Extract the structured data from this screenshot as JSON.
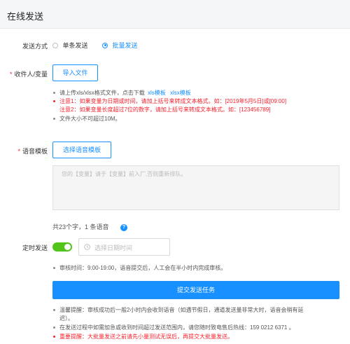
{
  "header": {
    "title": "在线发送"
  },
  "send_mode": {
    "label": "发送方式",
    "options": [
      {
        "label": "单条发送",
        "selected": false
      },
      {
        "label": "批量发送",
        "selected": true
      }
    ]
  },
  "recipients": {
    "label": "收件人/变量",
    "import_button": "导入文件",
    "notes": {
      "line1_prefix": "请上传xls/xlsx格式文件，点击下载",
      "xls_link": "xls模板",
      "xlsx_link": "xlsx模板",
      "line2": "注意1：如果变量为日期或时间，请加上括号来转成文本格式。如：[2019年5月5日]或[09:00]",
      "line3": "注意2：如果变量长度超过7位的数字，请加上括号来转成文本格式。如：[123456789]",
      "line4": "文件大小不可超过10M。"
    }
  },
  "voice_template": {
    "label": "语音模板",
    "choose_button": "选择语音模板",
    "content": "您的【变量】请于【变量】前入厂,否则重新排队。",
    "count_text": "共23个字，1 条语音",
    "help_symbol": "?"
  },
  "schedule": {
    "label": "定时发送",
    "enabled": true,
    "date_placeholder": "选择日期时间",
    "review_note": "审核时间：9:00-19:00，语音提交后，人工会在半小时内完成审核。"
  },
  "submit": {
    "label": "提交发送任务"
  },
  "tips": {
    "line1": "温馨提醒：审核成功后一般2小时内会收到语音（如遇节假日，通道发送量非常大时，语音会稍有延",
    "line1b": "迟）。",
    "line2": "在发送过程中如需加急或收到时间超过发送范围内，请您随时致电售后热线：159 0212 6371 。",
    "line3": "重要提醒：大批量发送之前请先小量测试无误后，再提交大批量发送。"
  },
  "colors": {
    "accent": "#1890ff",
    "warning": "#f5222d",
    "toggle_on": "#52c41a"
  }
}
